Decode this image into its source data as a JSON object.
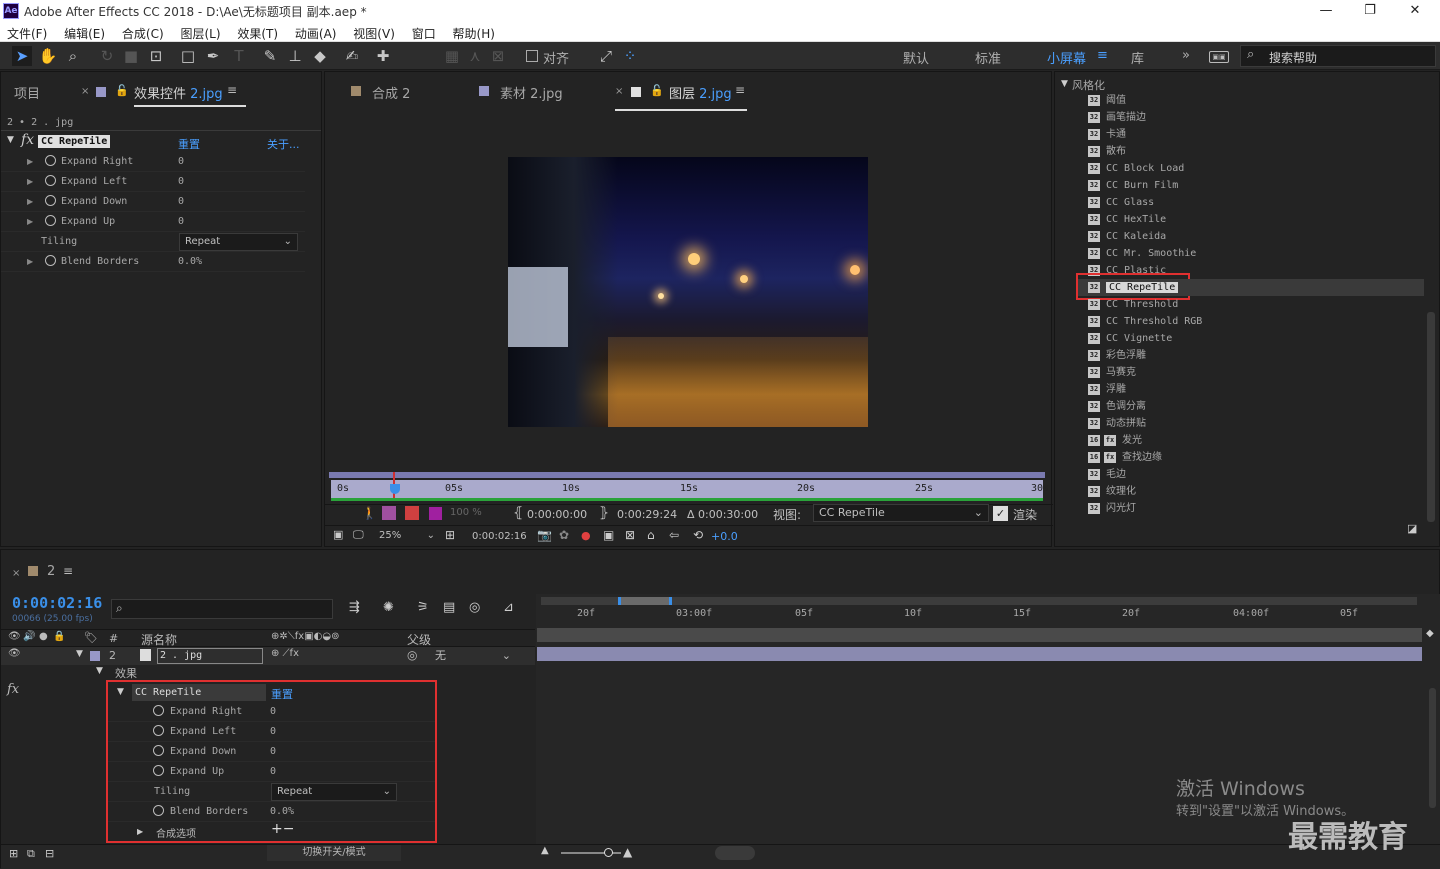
{
  "app": {
    "logo": "Ae",
    "title": "Adobe After Effects CC 2018 - D:\\Ae\\无标题项目 副本.aep *",
    "window_buttons": [
      "—",
      "❐",
      "✕"
    ]
  },
  "menu": [
    "文件(F)",
    "编辑(E)",
    "合成(C)",
    "图层(L)",
    "效果(T)",
    "动画(A)",
    "视图(V)",
    "窗口",
    "帮助(H)"
  ],
  "toolbar": {
    "snap_label": "对齐",
    "workspaces": [
      "默认",
      "标准",
      "小屏幕",
      "库"
    ],
    "active_workspace": "小屏幕",
    "help_placeholder": "搜索帮助"
  },
  "left_panel": {
    "tab_project": "项目",
    "tab_effects_prefix": "效果控件",
    "tab_effects_file": "2.jpg",
    "breadcrumb": "2 • 2 . jpg",
    "effect_name": "CC RepeTile",
    "reset": "重置",
    "about": "关于...",
    "params": [
      {
        "name": "Expand Right",
        "value": "0"
      },
      {
        "name": "Expand Left",
        "value": "0"
      },
      {
        "name": "Expand Down",
        "value": "0"
      },
      {
        "name": "Expand Up",
        "value": "0"
      }
    ],
    "tiling_label": "Tiling",
    "tiling_value": "Repeat",
    "blend_label": "Blend Borders",
    "blend_value": "0.0%"
  },
  "viewer": {
    "tabs": [
      {
        "label": "合成 2"
      },
      {
        "label": "素材 2.jpg"
      },
      {
        "label_prefix": "图层",
        "label_file": "2.jpg"
      }
    ],
    "ruler": [
      "0s",
      "05s",
      "10s",
      "15s",
      "20s",
      "25s",
      "30s"
    ],
    "time_start": "0:00:00:00",
    "time_end": "0:00:29:24",
    "duration": "Δ 0:00:30:00",
    "view_label": "视图:",
    "view_value": "CC RepeTile",
    "render_label": "渲染",
    "zoom": "25%",
    "current_time": "0:00:02:16",
    "exposure": "+0.0",
    "opacity": "100 %"
  },
  "effects_panel": {
    "category": "风格化",
    "items": [
      "阈值",
      "画笔描边",
      "卡通",
      "散布",
      "CC Block Load",
      "CC Burn Film",
      "CC Glass",
      "CC HexTile",
      "CC Kaleida",
      "CC Mr. Smoothie",
      "CC Plastic",
      "CC RepeTile",
      "CC Threshold",
      "CC Threshold RGB",
      "CC Vignette",
      "彩色浮雕",
      "马赛克",
      "浮雕",
      "色调分离",
      "动态拼贴",
      "发光",
      "查找边缘",
      "毛边",
      "纹理化",
      "闪光灯"
    ],
    "selected": "CC RepeTile"
  },
  "timeline": {
    "comp_tab": "2",
    "timecode": "0:00:02:16",
    "fps": "00066 (25.00 fps)",
    "col_num": "#",
    "col_source": "源名称",
    "col_parent": "父级",
    "layer_num": "2",
    "layer_name": "2 . jpg",
    "parent_value": "无",
    "effects_group": "效果",
    "effect_name": "CC RepeTile",
    "reset": "重置",
    "params": [
      {
        "name": "Expand Right",
        "value": "0"
      },
      {
        "name": "Expand Left",
        "value": "0"
      },
      {
        "name": "Expand Down",
        "value": "0"
      },
      {
        "name": "Expand Up",
        "value": "0"
      }
    ],
    "tiling_label": "Tiling",
    "tiling_value": "Repeat",
    "blend_label": "Blend Borders",
    "blend_value": "0.0%",
    "compositing_options": "合成选项",
    "compositing_plusminus": "+−",
    "ruler": [
      "20f",
      "03:00f",
      "05f",
      "10f",
      "15f",
      "20f",
      "04:00f",
      "05f"
    ],
    "toggle_modes": "切换开关/模式"
  },
  "watermark": {
    "line1": "激活 Windows",
    "line2": "转到\"设置\"以激活 Windows。",
    "brand": "最需教育"
  }
}
